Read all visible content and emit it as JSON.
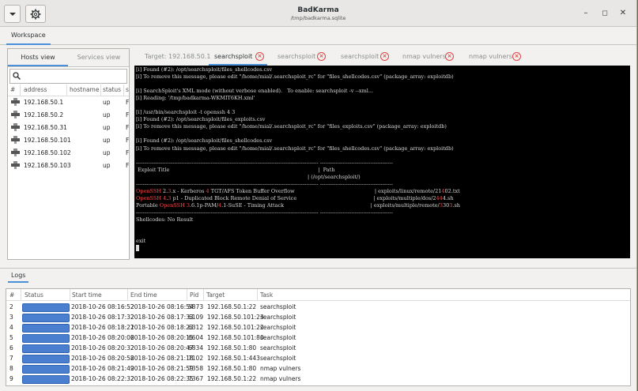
{
  "window": {
    "title": "BadKarma",
    "subtitle": "/tmp/badkarma.sqlite",
    "workspace_tab": "Workspace",
    "minimize": "–",
    "maximize": "◻",
    "close": "✕"
  },
  "left_panel": {
    "tabs": [
      "Hosts view",
      "Services view"
    ],
    "columns": [
      "#",
      "address",
      "hostname",
      "status",
      "s"
    ],
    "hosts": [
      {
        "address": "192.168.50.1",
        "status": "up",
        "s": "F"
      },
      {
        "address": "192.168.50.2",
        "status": "up",
        "s": "F"
      },
      {
        "address": "192.168.50.31",
        "status": "up",
        "s": "F"
      },
      {
        "address": "192.168.50.101",
        "status": "up",
        "s": "F"
      },
      {
        "address": "192.168.50.102",
        "status": "up",
        "s": "F"
      },
      {
        "address": "192.168.50.103",
        "status": "up",
        "s": "F"
      }
    ]
  },
  "right_panel": {
    "target_label": "Target: 192.168.50.1",
    "tabs": [
      "searchsploit",
      "searchsploit",
      "searchsploit",
      "nmap vulners",
      "nmap vulners"
    ]
  },
  "terminal": {
    "lines": [
      "[i] Found (#2): /opt/searchsploit/files_shellcodes.csv",
      "[i] To remove this message, please edit \"/home/mial/.searchsploit_rc\" for \"files_shellcodes.csv\" (package_array: exploitdb)",
      "",
      "[i] SearchSploit's XML mode (without verbose enabled).   To enable: searchsploit -v --xml...",
      "[i] Reading: '/tmp/badkarma-WKMIT6KH.xml'",
      "",
      "[i] /usr/bin/searchsploit -t openssh 4 3",
      "[i] Found (#2): /opt/searchsploit/files_exploits.csv",
      "[i] To remove this message, please edit \"/home/mial/.searchsploit_rc\" for \"files_exploits.csv\" (package_array: exploitdb)",
      "",
      "[i] Found (#2): /opt/searchsploit/files_shellcodes.csv",
      "[i] To remove this message, please edit \"/home/mial/.searchsploit_rc\" for \"files_shellcodes.csv\" (package_array: exploitdb)",
      "",
      "--------------------------------------------------------------------------------------------------------- ------------------------------------------",
      " Exploit Title                                                                                           |  Path",
      "                                                                                                         | (/opt/searchsploit/)",
      "--------------------------------------------------------------------------------------------------------- ------------------------------------------",
      "OpenSSH 2.3.x - Kerberos 4 TGT/AFS Token Buffer Overflow                                                 | exploits/linux/remote/21402.txt",
      "OpenSSH 4.3 p1 - Duplicated Block Remote Denial of Service                                               | exploits/multiple/dos/2444.sh",
      "Portable OpenSSH 3.6.1p-PAM/4.1-SuSE - Timing Attack                                                     | exploits/multiple/remote/3303.sh",
      "--------------------------------------------------------------------------------------------------------- ------------------------------------------",
      "Shellcodes: No Result",
      "",
      "",
      "exit"
    ]
  },
  "logs": {
    "tab": "Logs",
    "columns": [
      "#",
      "Status",
      "Start time",
      "End time",
      "Pid",
      "Target",
      "Task"
    ],
    "rows": [
      {
        "n": "2",
        "start": "2018-10-26 08:16:52",
        "end": "2018-10-26 08:16:54",
        "pid": "5873",
        "target": "192.168.50.1:22",
        "task": "searchsploit"
      },
      {
        "n": "3",
        "start": "2018-10-26 08:17:32",
        "end": "2018-10-26 08:17:33",
        "pid": "6109",
        "target": "192.168.50.101:23",
        "task": "searchsploit"
      },
      {
        "n": "4",
        "start": "2018-10-26 08:18:21",
        "end": "2018-10-26 08:18:23",
        "pid": "6312",
        "target": "192.168.50.101:22",
        "task": "searchsploit"
      },
      {
        "n": "5",
        "start": "2018-10-26 08:20:06",
        "end": "2018-10-26 08:20:15",
        "pid": "6604",
        "target": "192.168.50.101:80",
        "task": "searchsploit"
      },
      {
        "n": "6",
        "start": "2018-10-26 08:20:32",
        "end": "2018-10-26 08:20:47",
        "pid": "6834",
        "target": "192.168.50.1:80",
        "task": "searchsploit"
      },
      {
        "n": "7",
        "start": "2018-10-26 08:20:58",
        "end": "2018-10-26 08:21:18",
        "pid": "7102",
        "target": "192.168.50.1:443",
        "task": "searchsploit"
      },
      {
        "n": "8",
        "start": "2018-10-26 08:21:49",
        "end": "2018-10-26 08:21:59",
        "pid": "7358",
        "target": "192.168.50.1:80",
        "task": "nmap vulners"
      },
      {
        "n": "9",
        "start": "2018-10-26 08:22:32",
        "end": "2018-10-26 08:22:35",
        "pid": "7367",
        "target": "192.168.50.1:22",
        "task": "nmap vulners"
      }
    ]
  },
  "colors": {
    "accent": "#4a90d9",
    "close_red": "#e04545",
    "terminal_bg": "#000000",
    "highlight_red": "#f04c4c",
    "progress": "#4a7fd0"
  }
}
